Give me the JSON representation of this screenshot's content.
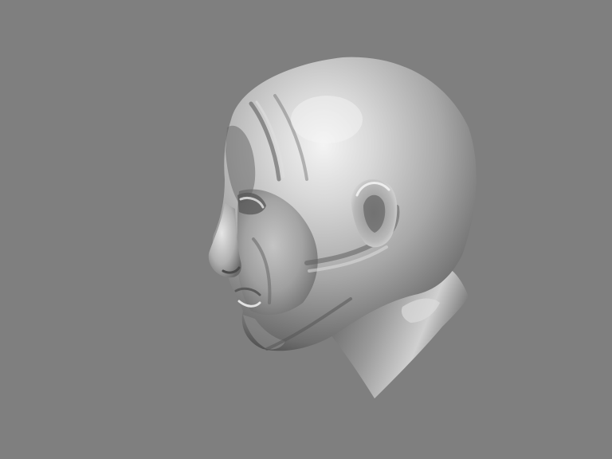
{
  "viewport": {
    "background_color": "#7f7f7f",
    "subject": "head-sculpt-render"
  },
  "model": {
    "material_colors": {
      "highlight": "#f2f2f2",
      "light": "#cfcfcf",
      "mid": "#9e9e9e",
      "shadow": "#555555",
      "deep_shadow": "#333333"
    }
  }
}
